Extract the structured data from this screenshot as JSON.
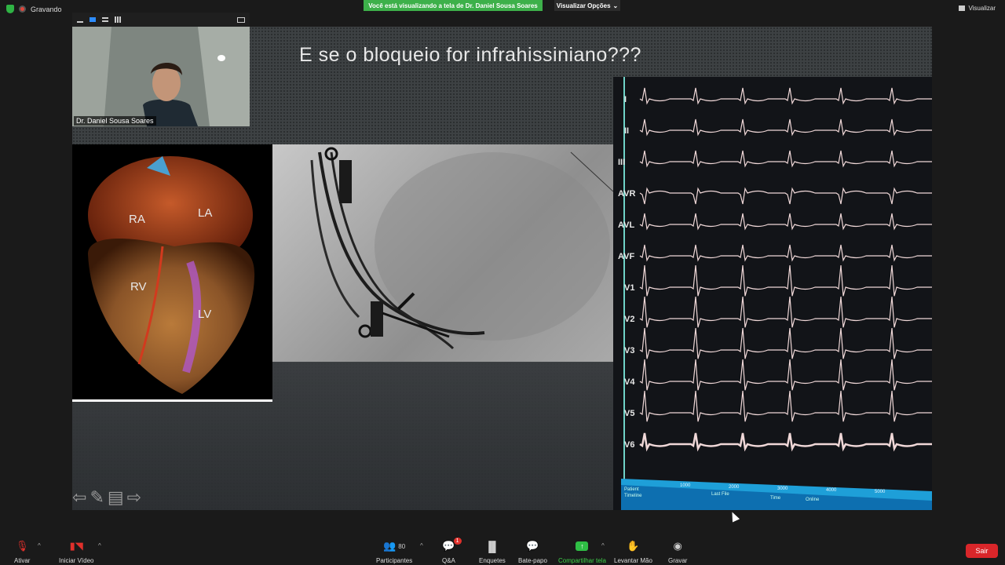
{
  "status": {
    "recording_label": "Gravando"
  },
  "share_banner": {
    "text": "Você está visualizando a tela de Dr. Daniel Sousa Soares"
  },
  "view_options": {
    "label": "Visualizar Opções"
  },
  "view_button": {
    "label": "Visualizar"
  },
  "self_video": {
    "name": "Dr. Daniel Sousa Soares"
  },
  "slide": {
    "title": "E se o bloqueio for infrahissiniano???",
    "heart_labels": [
      "RA",
      "LA",
      "RV",
      "LV"
    ],
    "ecg_leads": [
      "I",
      "II",
      "III",
      "AVR",
      "AVL",
      "AVF",
      "V1",
      "V2",
      "V3",
      "V4",
      "V5",
      "V6"
    ],
    "ecg_footer": {
      "patient": "Patient",
      "lastfile": "Last File",
      "time": "Time",
      "online": "Online",
      "timeline": "Timeline",
      "ticks": [
        "1000",
        "2000",
        "3000",
        "4000",
        "5000"
      ]
    }
  },
  "toolbar": {
    "mute": "Ativar",
    "video": "Iniciar Vídeo",
    "participants": "Participantes",
    "participant_count": "80",
    "qa": "Q&A",
    "qa_badge": "1",
    "polls": "Enquetes",
    "chat": "Bate-papo",
    "share": "Compartilhar tela",
    "raise_hand": "Levantar Mão",
    "record": "Gravar",
    "leave": "Sair"
  },
  "colors": {
    "share_green": "#3db04a",
    "leave_red": "#d9262a",
    "ecg_bg": "#121418"
  }
}
